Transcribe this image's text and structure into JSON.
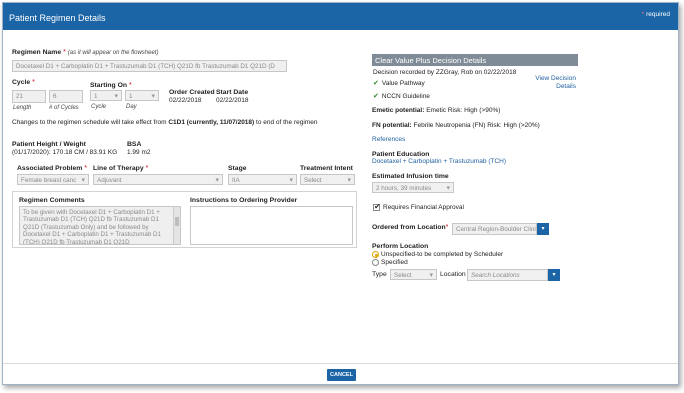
{
  "dialog": {
    "title": "Patient Regimen Details",
    "required_note": "required",
    "cancel_label": "CANCEL"
  },
  "regimen": {
    "name_label": "Regimen Name",
    "name_hint": "(as it will appear on the flowsheet)",
    "name_value": "Docetaxel D1 + Carboplatin D1 + Trastuzumab D1 (TCH) Q21D fb Trastuzumab D1 Q21D (D",
    "cycle_label": "Cycle",
    "cycle_value": "21",
    "cycles_value": "6",
    "length_label": "Length",
    "num_cycles_label": "# of Cycles",
    "starting_on_label": "Starting On",
    "start_cycle_value": "1",
    "start_day_value": "1",
    "cycle_sub": "Cycle",
    "day_sub": "Day",
    "order_created_label": "Order Created",
    "order_created_value": "02/22/2018",
    "start_date_label": "Start Date",
    "start_date_value": "02/22/2018",
    "schedule_notice_pre": "Changes to the regimen schedule will take effect from ",
    "schedule_notice_bold": "C1D1 (currently, 11/07/2018)",
    "schedule_notice_post": " to end of the regimen"
  },
  "patient": {
    "height_weight_label": "Patient Height / Weight",
    "height_weight_value": "(01/17/2020): 170.18 CM / 83.91 KG",
    "bsa_label": "BSA",
    "bsa_value": "1.99 m2"
  },
  "problem": {
    "associated_label": "Associated Problem",
    "associated_value": "Female breast canc",
    "therapy_label": "Line of Therapy",
    "therapy_value": "Adjuvant",
    "stage_label": "Stage",
    "stage_value": "IIA",
    "intent_label": "Treatment Intent",
    "intent_value": "Select"
  },
  "comments": {
    "label": "Regimen Comments",
    "text": "To be given with Docetaxel D1 + Carboplatin D1 + Trastuzumab D1 (TCH) Q21D fb Trastuzumab D1 Q21D (Trastuzumab Only) and be followed by Docetaxel D1 + Carboplatin D1 + Trastuzumab D1 (TCH) Q21D fb Trastuzumab D1 Q21D",
    "instructions_label": "Instructions to Ordering Provider"
  },
  "decision": {
    "header": "Clear Value Plus Decision Details",
    "recorded": "Decision recorded by ZZGray, Rob on 02/22/2018",
    "item1": "Value Pathway",
    "item2": "NCCN Guideline",
    "view_link_1": "View Decision",
    "view_link_2": "Details"
  },
  "risk": {
    "emetic_label": "Emetic potential:",
    "emetic_value": "Emetic Risk: High (>90%)",
    "fn_label": "FN potential:",
    "fn_value": "Febrile Neutropenia (FN) Risk: High (>20%)",
    "references": "References"
  },
  "education": {
    "label": "Patient Education",
    "link": "Docetaxel + Carboplatin + Trastuzumab (TCH)"
  },
  "infusion": {
    "label": "Estimated Infusion time",
    "value": "2 hours, 39 minutes"
  },
  "financial": {
    "label": "Requires Financial Approval",
    "checked": true
  },
  "ordered_from": {
    "label": "Ordered from Location",
    "value": "Central Region-Boulder Clini"
  },
  "perform": {
    "label": "Perform Location",
    "option1": "Unspecified-to be completed by Scheduler",
    "option2": "Specified",
    "type_label": "Type",
    "type_value": "Select",
    "location_label": "Location",
    "location_placeholder": "Search Locations"
  },
  "colors": {
    "titlebar": "#1b65a6",
    "link": "#1f5f9f",
    "decision_header": "#7f8c97",
    "check": "#2f8a2f"
  }
}
